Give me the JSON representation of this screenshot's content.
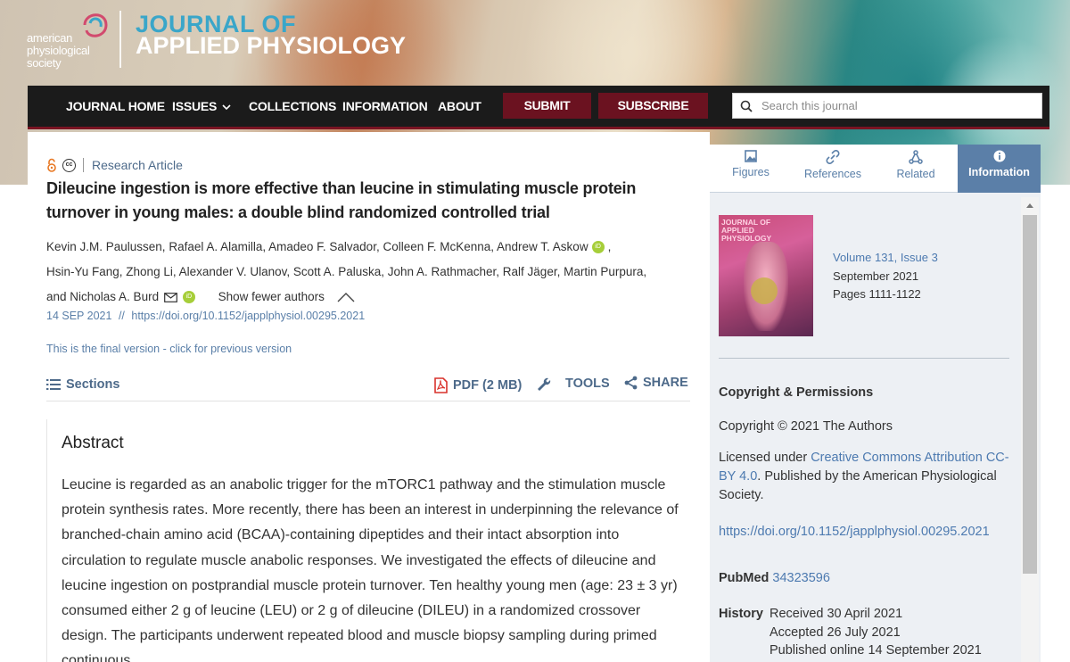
{
  "header": {
    "publisher_lines": [
      "american",
      "physiological",
      "society"
    ],
    "journal_line1": "JOURNAL OF",
    "journal_line2": "APPLIED PHYSIOLOGY",
    "colors": {
      "journal_accent": "#3aa6c9",
      "nav_bg": "#1b1b1b",
      "nav_button": "#6b1220"
    }
  },
  "nav": {
    "items": [
      "JOURNAL HOME",
      "ISSUES",
      "COLLECTIONS",
      "INFORMATION",
      "ABOUT"
    ],
    "submit": "SUBMIT",
    "subscribe": "SUBSCRIBE",
    "search_placeholder": "Search this journal"
  },
  "article": {
    "type": "Research Article",
    "title": "Dileucine ingestion is more effective than leucine in stimulating muscle protein turnover in young males: a double blind randomized controlled trial",
    "authors_line1": "Kevin J.M. Paulussen, Rafael A. Alamilla, Amadeo F. Salvador, Colleen F. McKenna, Andrew T. Askow",
    "authors_line1_tail": ",",
    "authors_line2": "Hsin-Yu Fang, Zhong Li, Alexander V. Ulanov, Scott A. Paluska, John A. Rathmacher, Ralf Jäger, Martin Purpura,",
    "authors_line3": "and Nicholas A. Burd",
    "orcid_label": "iD",
    "show_fewer": "Show fewer authors",
    "date": "14 SEP 2021",
    "date_sep": "//",
    "doi": "https://doi.org/10.1152/japplphysiol.00295.2021",
    "final_version": "This is the final version - click for previous version",
    "sections": "Sections",
    "pdf": "PDF (2 MB)",
    "tools": "TOOLS",
    "share": "SHARE",
    "abstract_title": "Abstract",
    "abstract_text": "Leucine is regarded as an anabolic trigger for the mTORC1 pathway and the stimulation muscle protein synthesis rates. More recently, there has been an interest in underpinning the relevance of branched-chain amino acid (BCAA)-containing dipeptides and their intact absorption into circulation to regulate muscle anabolic responses. We investigated the effects of dileucine and leucine ingestion on postprandial muscle protein turnover. Ten healthy young men (age: 23 ± 3 yr) consumed either 2 g of leucine (LEU) or 2 g of dileucine (DILEU) in a randomized crossover design. The participants underwent repeated blood and muscle biopsy sampling during primed continuous"
  },
  "sidebar": {
    "tabs": [
      "Figures",
      "References",
      "Related",
      "Information"
    ],
    "cover_title_line1": "JOURNAL OF",
    "cover_title_line2": "APPLIED",
    "cover_title_line3": "PHYSIOLOGY",
    "volume": "Volume 131,",
    "issue": "Issue 3",
    "month": "September 2021",
    "pages": "Pages 1111-1122",
    "copyright_heading": "Copyright & Permissions",
    "copyright_text": "Copyright © 2021 The Authors",
    "licensed_prefix": "Licensed under ",
    "license_link": "Creative Commons Attribution CC-BY 4.0",
    "licensed_suffix": ". Published by the American Physiological Society.",
    "doi_link": "https://doi.org/10.1152/japplphysiol.00295.2021",
    "pubmed_label": "PubMed",
    "pubmed_id": "34323596",
    "history_label": "History",
    "history": [
      "Received 30 April 2021",
      "Accepted 26 July 2021",
      "Published online 14 September 2021"
    ]
  }
}
